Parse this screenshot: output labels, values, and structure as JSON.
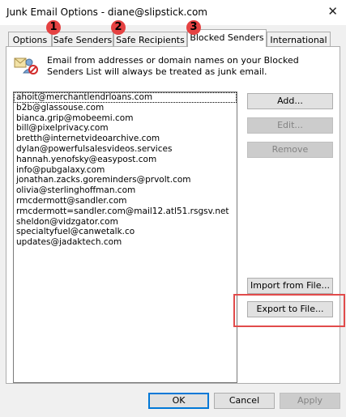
{
  "window": {
    "title": "Junk Email Options - diane@slipstick.com",
    "close_glyph": "✕"
  },
  "tabs": [
    {
      "label": "Options"
    },
    {
      "label": "Safe Senders"
    },
    {
      "label": "Safe Recipients"
    },
    {
      "label": "Blocked Senders"
    },
    {
      "label": "International"
    }
  ],
  "badges": [
    "1",
    "2",
    "3"
  ],
  "description": "Email from addresses or domain names on your Blocked Senders List will always be treated as junk email.",
  "blocked_senders": [
    "ahoit@merchantlendrloans.com",
    "b2b@glassouse.com",
    "bianca.grip@mobeemi.com",
    "bill@pixelprivacy.com",
    "bretth@internetvideoarchive.com",
    "dylan@powerfulsalesvideos.services",
    "hannah.yenofsky@easypost.com",
    "info@pubgalaxy.com",
    "jonathan.zacks.goreminders@prvolt.com",
    "olivia@sterlinghoffman.com",
    "rmcdermott@sandler.com",
    "rmcdermott=sandler.com@mail12.atl51.rsgsv.net",
    "sheldon@vidzgator.com",
    "specialtyfuel@canwetalk.co",
    "updates@jadaktech.com"
  ],
  "buttons": {
    "add": "Add...",
    "edit": "Edit...",
    "remove": "Remove",
    "import": "Import from File...",
    "export": "Export to File...",
    "ok": "OK",
    "cancel": "Cancel",
    "apply": "Apply"
  },
  "colors": {
    "badge": "#e54242",
    "highlight": "#e14b4b",
    "primary_border": "#0078d7"
  }
}
